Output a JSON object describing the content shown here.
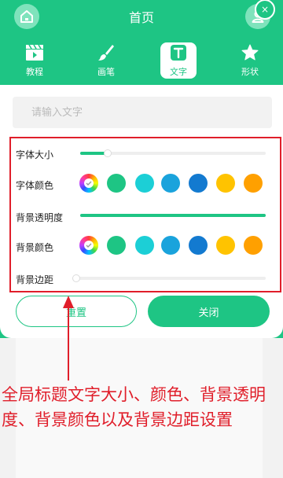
{
  "header": {
    "title": "首页",
    "tabs": [
      {
        "label": "教程",
        "icon": "clapperboard-icon"
      },
      {
        "label": "画笔",
        "icon": "brush-icon"
      },
      {
        "label": "文字",
        "icon": "text-tool-icon",
        "active": true
      },
      {
        "label": "形状",
        "icon": "star-icon"
      }
    ],
    "corner_badge": "×"
  },
  "text_input": {
    "placeholder": "请输入文字",
    "value": ""
  },
  "settings": {
    "font_size": {
      "label": "字体大小",
      "value_fraction": 0.15
    },
    "font_color": {
      "label": "字体颜色"
    },
    "bg_opacity": {
      "label": "背景透明度",
      "value_fraction": 1.0
    },
    "bg_color": {
      "label": "背景颜色"
    },
    "bg_padding": {
      "label": "背景边距",
      "value_fraction": 0.0
    },
    "swatch_colors": [
      "#1ec584",
      "#1ccfd6",
      "#1aa3dc",
      "#137ad0",
      "#ffc300",
      "#ffa000"
    ]
  },
  "buttons": {
    "reset": "重置",
    "close": "关闭"
  },
  "annotation": "全局标题文字大小、颜色、背景透明度、背景颜色以及背景边距设置",
  "colors": {
    "accent": "#1ec584",
    "highlight": "#e01e2a"
  }
}
